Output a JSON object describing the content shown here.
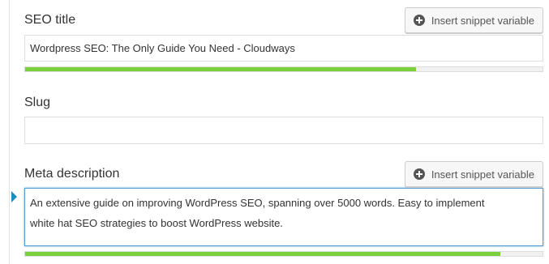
{
  "seo_title": {
    "label": "SEO title",
    "snippet_button": "Insert snippet variable",
    "snippet_icon": "plus-circle-icon",
    "value": "Wordpress SEO: The Only Guide You Need - Cloudways",
    "progress_fraction": 0.756
  },
  "slug": {
    "label": "Slug",
    "value": ""
  },
  "meta_description": {
    "label": "Meta description",
    "snippet_button": "Insert snippet variable",
    "snippet_icon": "plus-circle-icon",
    "value": "An extensive guide on improving WordPress SEO, spanning over 5000 words. Easy to implement\nwhite hat SEO strategies to boost WordPress website.",
    "progress_fraction": 0.918
  },
  "colors": {
    "progress_good": "#7ad03a",
    "focus_border": "#5b9dd9",
    "focus_indicator": "#1e8cbe"
  }
}
